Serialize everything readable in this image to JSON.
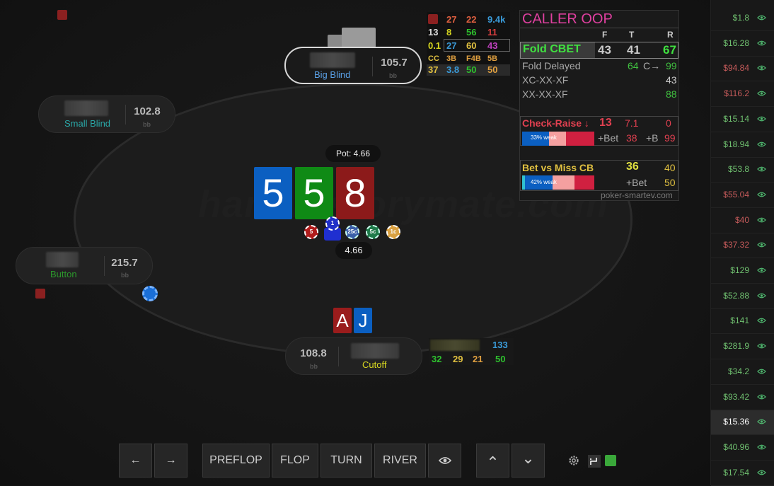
{
  "table": {
    "watermark": "handhistorymate.com",
    "pot_label": "Pot: 4.66",
    "bet_amount": "4.66",
    "bb_unit": "bb"
  },
  "seats": {
    "big_blind": {
      "position": "Big Blind",
      "stack": "105.7"
    },
    "small_blind": {
      "position": "Small Blind",
      "stack": "102.8"
    },
    "button": {
      "position": "Button",
      "stack": "215.7"
    },
    "cutoff": {
      "position": "Cutoff",
      "stack": "108.8"
    }
  },
  "board": [
    {
      "rank": "5",
      "color": "#0b5fc1"
    },
    {
      "rank": "5",
      "color": "#0f8a15"
    },
    {
      "rank": "8",
      "color": "#8c1a1a"
    }
  ],
  "hero_cards": [
    {
      "rank": "A",
      "color": "#9a1c1c"
    },
    {
      "rank": "J",
      "color": "#0b5fc1"
    }
  ],
  "chips": [
    "5",
    "1",
    "25c",
    "5c",
    "1c"
  ],
  "hud_bb": {
    "row1": [
      "",
      "27",
      "22",
      "9.4k"
    ],
    "row2": [
      "13",
      "8",
      "56",
      "11"
    ],
    "row3": [
      "0.1",
      "27",
      "60",
      "43"
    ],
    "row4_labels": [
      "CC",
      "3B",
      "F4B",
      "5B"
    ],
    "row5": [
      "37",
      "3.8",
      "50",
      "50"
    ]
  },
  "hud_cutoff": {
    "top": "133",
    "row": [
      "32",
      "29",
      "21",
      "50"
    ]
  },
  "panel": {
    "title": "CALLER OOP",
    "headers": [
      "F",
      "T",
      "R"
    ],
    "fold_cbet": {
      "label": "Fold CBET",
      "f": "43",
      "t": "41",
      "r": "67"
    },
    "fold_delayed": {
      "label": "Fold Delayed",
      "v1": "64",
      "c_label": "C→",
      "v2": "99"
    },
    "xc_xx_xf": {
      "label": "XC-XX-XF",
      "v": "43"
    },
    "xx_xx_xf": {
      "label": "XX-XX-XF",
      "v": "88"
    },
    "check_raise": {
      "label": "Check-Raise ↓",
      "v1": "13",
      "v2": "7.1",
      "v3": "0",
      "bar": "33% weak",
      "plus_bet": "+Bet",
      "v4": "38",
      "plus_b": "+B",
      "v5": "99"
    },
    "bet_vs_miss": {
      "label": "Bet vs Miss CB",
      "v1": "36",
      "v2": "40",
      "bar": "42% weak",
      "plus_bet": "+Bet",
      "v3": "50"
    },
    "footer": "poker-smartev.com"
  },
  "controls": {
    "back": "←",
    "forward": "→",
    "preflop": "PREFLOP",
    "flop": "FLOP",
    "turn": "TURN",
    "river": "RIVER",
    "up": "⌃",
    "down": "⌄"
  },
  "sidebar": [
    {
      "amount": "$1.8",
      "color": "#6fbf6f"
    },
    {
      "amount": "$16.28",
      "color": "#6fbf6f"
    },
    {
      "amount": "$94.84",
      "color": "#c45a5a"
    },
    {
      "amount": "$116.2",
      "color": "#c45a5a"
    },
    {
      "amount": "$15.14",
      "color": "#6fbf6f"
    },
    {
      "amount": "$18.94",
      "color": "#6fbf6f"
    },
    {
      "amount": "$53.8",
      "color": "#6fbf6f"
    },
    {
      "amount": "$55.04",
      "color": "#c45a5a"
    },
    {
      "amount": "$40",
      "color": "#c45a5a"
    },
    {
      "amount": "$37.32",
      "color": "#c45a5a"
    },
    {
      "amount": "$129",
      "color": "#6fbf6f"
    },
    {
      "amount": "$52.88",
      "color": "#6fbf6f"
    },
    {
      "amount": "$141",
      "color": "#6fbf6f"
    },
    {
      "amount": "$281.9",
      "color": "#6fbf6f"
    },
    {
      "amount": "$34.2",
      "color": "#6fbf6f"
    },
    {
      "amount": "$93.42",
      "color": "#6fbf6f"
    },
    {
      "amount": "$15.36",
      "color": "#ffffff"
    },
    {
      "amount": "$40.96",
      "color": "#6fbf6f"
    },
    {
      "amount": "$17.54",
      "color": "#6fbf6f"
    }
  ]
}
